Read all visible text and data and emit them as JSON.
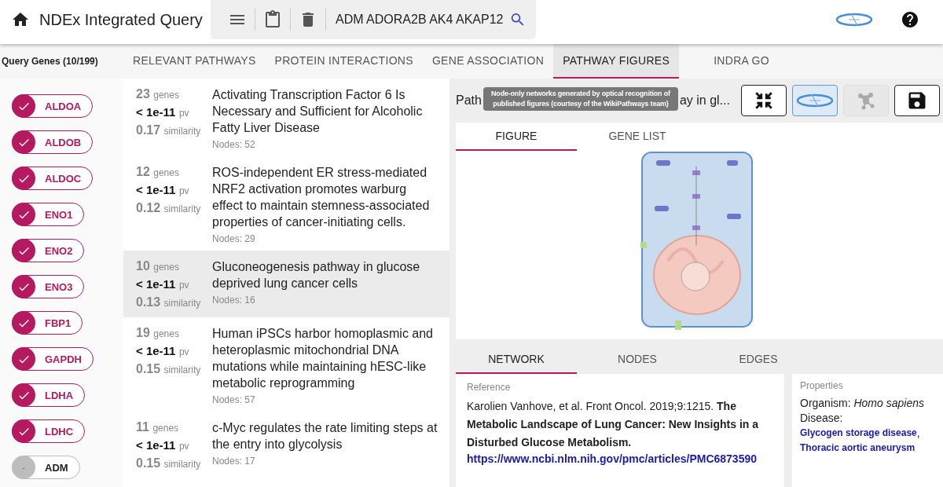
{
  "header": {
    "title": "NDEx Integrated Query",
    "search": {
      "value": "ADM ADORA2B AK4 AKAP12"
    }
  },
  "genes_panel": {
    "heading": "Query Genes (10/199)",
    "genes": [
      {
        "name": "ALDOA",
        "checked": true
      },
      {
        "name": "ALDOB",
        "checked": true
      },
      {
        "name": "ALDOC",
        "checked": true
      },
      {
        "name": "ENO1",
        "checked": true
      },
      {
        "name": "ENO2",
        "checked": true
      },
      {
        "name": "ENO3",
        "checked": true
      },
      {
        "name": "FBP1",
        "checked": true
      },
      {
        "name": "GAPDH",
        "checked": true
      },
      {
        "name": "LDHA",
        "checked": true
      },
      {
        "name": "LDHC",
        "checked": true
      },
      {
        "name": "ADM",
        "checked": false,
        "mark": "-"
      }
    ]
  },
  "tabs": [
    {
      "label": "RELEVANT PATHWAYS",
      "selected": false
    },
    {
      "label": "PROTEIN INTERACTIONS",
      "selected": false
    },
    {
      "label": "GENE ASSOCIATION",
      "selected": false
    },
    {
      "label": "PATHWAY FIGURES",
      "selected": true
    },
    {
      "label": "INDRA GO",
      "selected": false
    }
  ],
  "results": [
    {
      "genes": "23",
      "genes_unit": "genes",
      "pv": "< 1e-11",
      "pv_unit": "pv",
      "similarity": "0.17",
      "similarity_unit": "similarity",
      "title": "Activating Transcription Factor 6 Is Necessary and Sufficient for Alcoholic Fatty Liver Disease",
      "nodes": "Nodes: 52",
      "selected": false
    },
    {
      "genes": "12",
      "genes_unit": "genes",
      "pv": "< 1e-11",
      "pv_unit": "pv",
      "similarity": "0.12",
      "similarity_unit": "similarity",
      "title": "ROS-independent ER stress-mediated NRF2 activation promotes warburg effect to maintain stemness-associated properties of cancer-initiating cells.",
      "nodes": "Nodes: 29",
      "selected": false
    },
    {
      "genes": "10",
      "genes_unit": "genes",
      "pv": "< 1e-11",
      "pv_unit": "pv",
      "similarity": "0.13",
      "similarity_unit": "similarity",
      "title": "Gluconeogenesis pathway in glucose deprived lung cancer cells",
      "nodes": "Nodes: 16",
      "selected": true
    },
    {
      "genes": "19",
      "genes_unit": "genes",
      "pv": "< 1e-11",
      "pv_unit": "pv",
      "similarity": "0.15",
      "similarity_unit": "similarity",
      "title": "Human iPSCs harbor homoplasmic and heteroplasmic mitochondrial DNA mutations while maintaining hESC-like metabolic reprogramming",
      "nodes": "Nodes: 57",
      "selected": false
    },
    {
      "genes": "11",
      "genes_unit": "genes",
      "pv": "< 1e-11",
      "pv_unit": "pv",
      "similarity": "0.15",
      "similarity_unit": "similarity",
      "title": "c-Myc regulates the rate limiting steps at the entry into glycolysis",
      "nodes": "Nodes: 17",
      "selected": false
    }
  ],
  "network": {
    "title_start": "Path",
    "title_end": "ay in gl...",
    "tooltip": "Node-only networks generated by optical recognition of published figures (courtesy of the WikiPathways team)",
    "tools": [
      {
        "kind": "collapse",
        "selected": false,
        "disabled": false
      },
      {
        "kind": "logo",
        "selected": true,
        "disabled": false
      },
      {
        "kind": "network",
        "selected": false,
        "disabled": true
      },
      {
        "kind": "save",
        "selected": false,
        "disabled": false
      }
    ],
    "figure_tabs": [
      {
        "label": "FIGURE",
        "selected": true
      },
      {
        "label": "GENE LIST",
        "selected": false
      }
    ],
    "detail_tabs": [
      {
        "label": "NETWORK",
        "selected": true
      },
      {
        "label": "NODES",
        "selected": false
      },
      {
        "label": "EDGES",
        "selected": false
      }
    ],
    "reference": {
      "label": "Reference",
      "text": "Karolien Vanhove, et al. Front Oncol. 2019;9:1215. **The Metabolic Landscape of Lung Cancer: New Insights in a Disturbed Glucose Metabolism.**",
      "url": "https://www.ncbi.nlm.nih.gov/pmc/articles/PMC6873590"
    },
    "properties": {
      "label": "Properties",
      "organism": "Organism: *Homo sapiens*",
      "disease_label": "Disease:",
      "separator": ",",
      "diseases": [
        "Glycogen storage disease",
        "Thoracic aortic aneurysm"
      ]
    }
  }
}
